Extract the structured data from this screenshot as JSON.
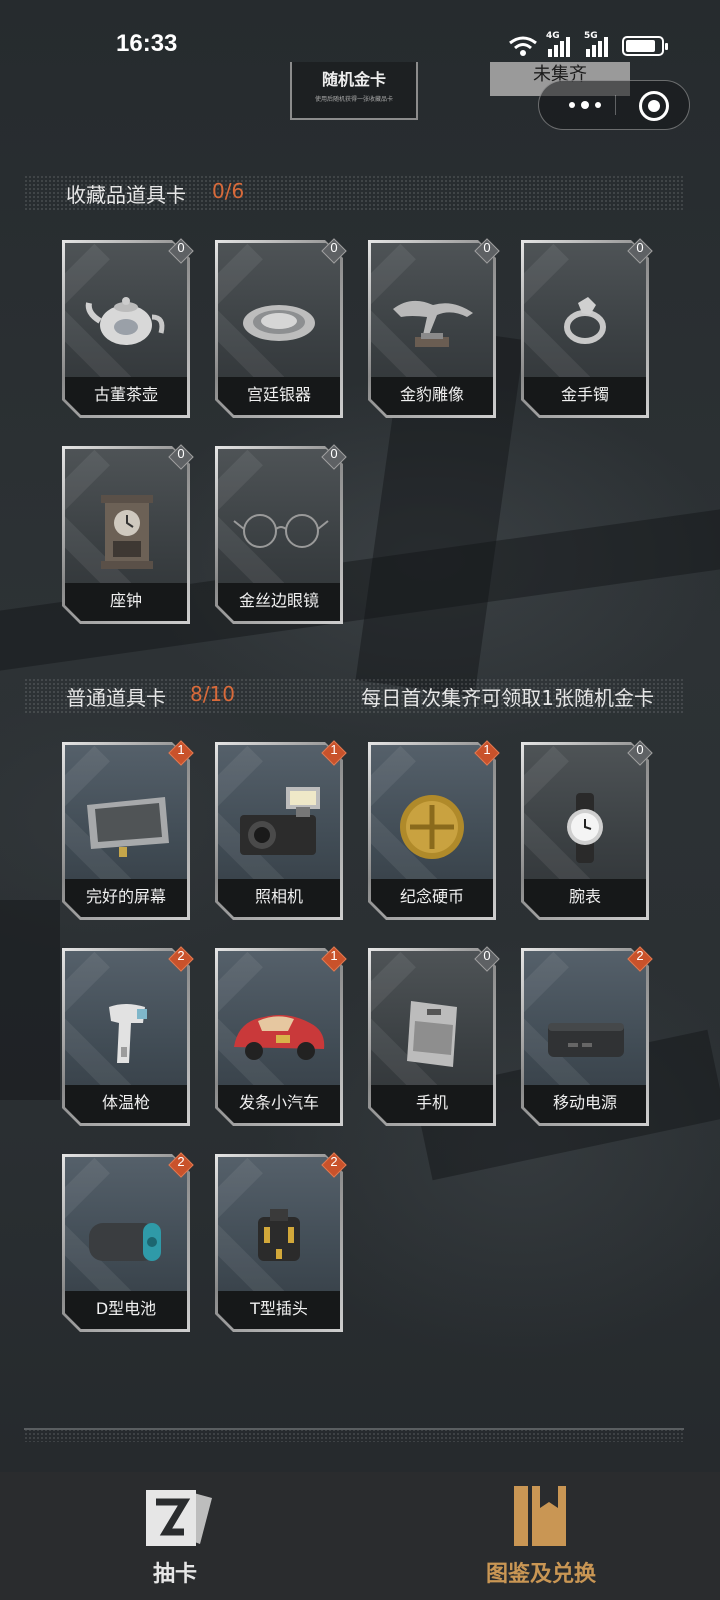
{
  "status_bar": {
    "time": "16:33",
    "network_1": "4G",
    "network_2": "5G",
    "battery_level": 0.85
  },
  "top": {
    "gold_card_title": "随机金卡",
    "gold_card_sub": "使用后随机获得一张收藏品卡",
    "incomplete_label": "未集齐"
  },
  "collectibles": {
    "title": "收藏品道具卡",
    "count": "0/6",
    "items": [
      {
        "name": "古董茶壶",
        "qty": "0",
        "icon": "teapot-icon"
      },
      {
        "name": "宫廷银器",
        "qty": "0",
        "icon": "silver-plate-icon"
      },
      {
        "name": "金豹雕像",
        "qty": "0",
        "icon": "leopard-statue-icon"
      },
      {
        "name": "金手镯",
        "qty": "0",
        "icon": "bracelet-icon"
      },
      {
        "name": "座钟",
        "qty": "0",
        "icon": "mantel-clock-icon"
      },
      {
        "name": "金丝边眼镜",
        "qty": "0",
        "icon": "glasses-icon"
      }
    ]
  },
  "common": {
    "title": "普通道具卡",
    "count": "8/10",
    "note": "每日首次集齐可领取1张随机金卡",
    "items": [
      {
        "name": "完好的屏幕",
        "qty": "1",
        "icon": "screen-icon"
      },
      {
        "name": "照相机",
        "qty": "1",
        "icon": "camera-icon"
      },
      {
        "name": "纪念硬币",
        "qty": "1",
        "icon": "coin-icon"
      },
      {
        "name": "腕表",
        "qty": "0",
        "icon": "watch-icon"
      },
      {
        "name": "体温枪",
        "qty": "2",
        "icon": "thermometer-gun-icon"
      },
      {
        "name": "发条小汽车",
        "qty": "1",
        "icon": "toy-car-icon"
      },
      {
        "name": "手机",
        "qty": "0",
        "icon": "phone-icon"
      },
      {
        "name": "移动电源",
        "qty": "2",
        "icon": "power-bank-icon"
      },
      {
        "name": "D型电池",
        "qty": "2",
        "icon": "battery-icon"
      },
      {
        "name": "T型插头",
        "qty": "2",
        "icon": "plug-icon"
      }
    ]
  },
  "tabbar": {
    "tabs": [
      {
        "label": "抽卡",
        "icon": "draw-card-icon",
        "active": false
      },
      {
        "label": "图鉴及兑换",
        "icon": "book-icon",
        "active": true
      }
    ]
  },
  "colors": {
    "accent": "#d86a3a",
    "active_tab": "#c99654",
    "badge_hot": "#c9522b"
  }
}
